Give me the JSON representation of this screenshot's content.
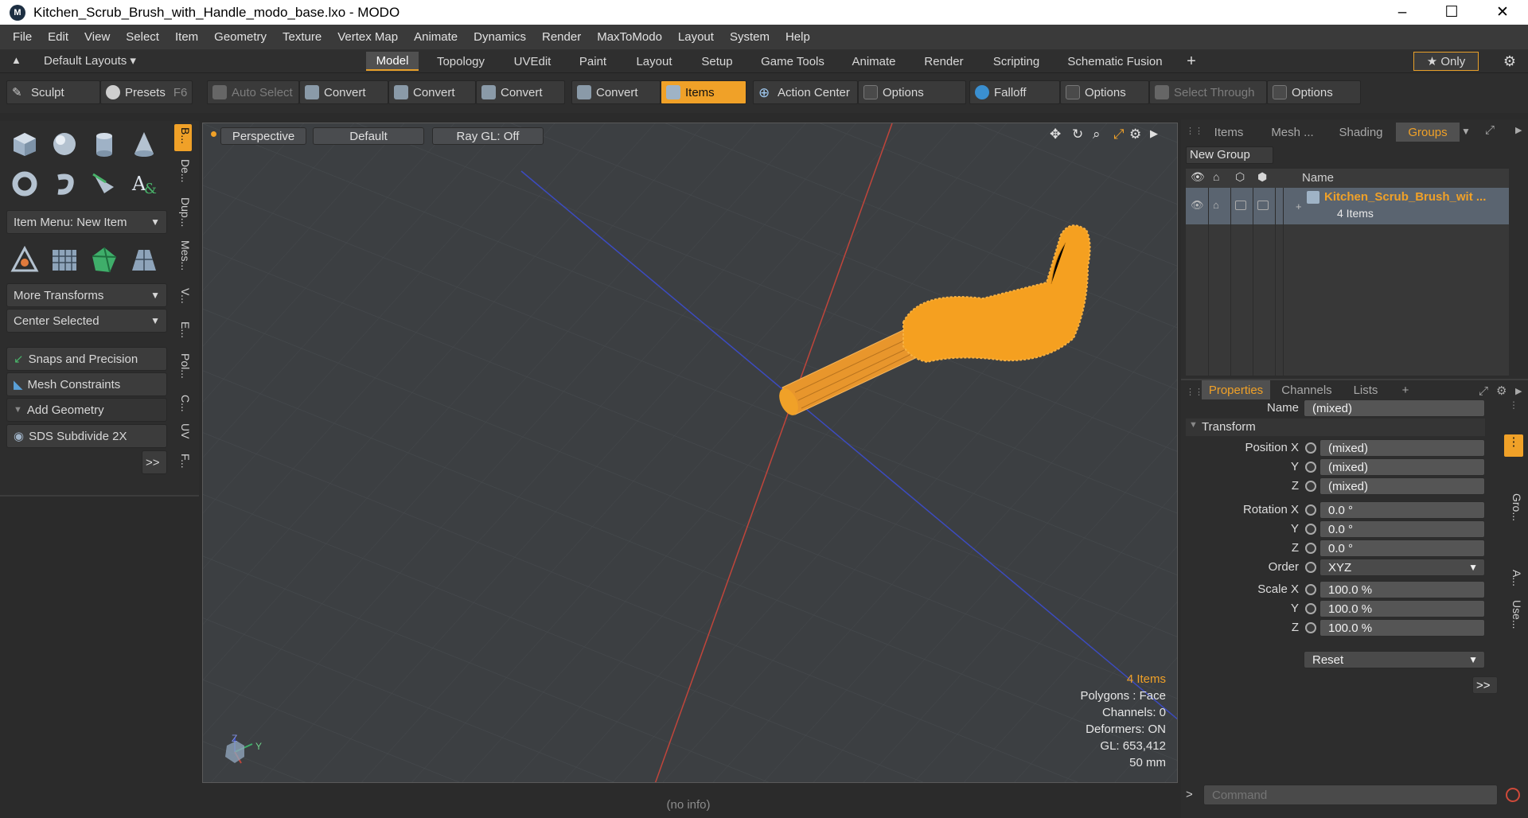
{
  "titlebar": {
    "title": "Kitchen_Scrub_Brush_with_Handle_modo_base.lxo - MODO",
    "min": "–",
    "max": "☐",
    "close": "✕"
  },
  "menu": [
    "File",
    "Edit",
    "View",
    "Select",
    "Item",
    "Geometry",
    "Texture",
    "Vertex Map",
    "Animate",
    "Dynamics",
    "Render",
    "MaxToModo",
    "Layout",
    "System",
    "Help"
  ],
  "layouts": {
    "label": "Default Layouts ▾"
  },
  "tabs": [
    "Model",
    "Topology",
    "UVEdit",
    "Paint",
    "Layout",
    "Setup",
    "Game Tools",
    "Animate",
    "Render",
    "Scripting",
    "Schematic Fusion"
  ],
  "tabs_add": "+",
  "only": "★  Only",
  "toolbar": {
    "sculpt": "Sculpt",
    "presets": "Presets",
    "presets_key": "F6",
    "auto_select": "Auto Select",
    "convert": "Convert",
    "items": "Items",
    "action_center": "Action Center",
    "options": "Options",
    "falloff": "Falloff",
    "select_through": "Select Through"
  },
  "left": {
    "item_menu": "Item Menu: New Item",
    "more_transforms": "More Transforms",
    "center_selected": "Center Selected",
    "snaps": "Snaps and Precision",
    "mesh_constraints": "Mesh Constraints",
    "add_geometry": "Add Geometry",
    "sds": "SDS Subdivide 2X",
    "more": ">>",
    "vtabs": [
      "B...",
      "De...",
      "Dup...",
      "Mes...",
      "V...",
      "E...",
      "Pol...",
      "C...",
      "UV",
      "F..."
    ]
  },
  "viewport": {
    "perspective": "Perspective",
    "default": "Default",
    "raygl": "Ray GL: Off",
    "info_items": "4 Items",
    "info_polygons": "Polygons : Face",
    "info_channels": "Channels: 0",
    "info_deformers": "Deformers: ON",
    "info_gl": "GL: 653,412",
    "info_scale": "50 mm",
    "axis_z": "Z",
    "axis_y": "Y"
  },
  "status": "(no info)",
  "right": {
    "tabs": [
      "Items",
      "Mesh ...",
      "Shading",
      "Groups"
    ],
    "new_group": "New Group",
    "col_name": "Name",
    "group_name": "Kitchen_Scrub_Brush_wit ...",
    "group_count": "4 Items",
    "ptabs": [
      "Properties",
      "Channels",
      "Lists"
    ],
    "ptabs_add": "+",
    "name_label": "Name",
    "name_value": "(mixed)",
    "transform": "Transform",
    "pos_label": "Position X",
    "y": "Y",
    "z": "Z",
    "mixed": "(mixed)",
    "rot_label": "Rotation X",
    "rot_val": "0.0 °",
    "order_label": "Order",
    "order_val": "XYZ",
    "scale_label": "Scale X",
    "scale_val": "100.0 %",
    "reset": "Reset",
    "more": ">>",
    "side_tabs": [
      "Gro...",
      "A...",
      "Use..."
    ],
    "command_prompt": ">",
    "command_placeholder": "Command"
  },
  "colors": {
    "accent": "#f0a128",
    "viewport_bg": "#3c3f42",
    "panel_bg": "#2d2d2d"
  }
}
